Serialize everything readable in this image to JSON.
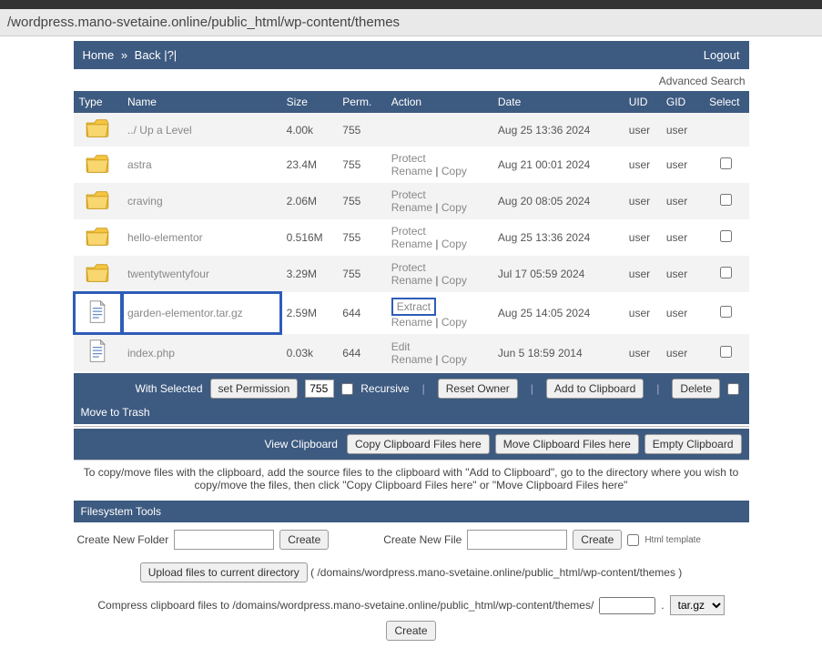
{
  "url": "/wordpress.mano-svetaine.online/public_html/wp-content/themes",
  "nav": {
    "home": "Home",
    "sep": "»",
    "back": "Back",
    "help": "|?|",
    "logout": "Logout"
  },
  "advanced": "Advanced Search",
  "headers": {
    "type": "Type",
    "name": "Name",
    "size": "Size",
    "perm": "Perm.",
    "action": "Action",
    "date": "Date",
    "uid": "UID",
    "gid": "GID",
    "select": "Select"
  },
  "rows": [
    {
      "kind": "folder",
      "name": "../ Up a Level",
      "size": "4.00k",
      "perm": "755",
      "actions": [],
      "date": "Aug 25 13:36 2024",
      "uid": "user",
      "gid": "user",
      "checkbox": false,
      "odd": true
    },
    {
      "kind": "folder",
      "name": "astra",
      "size": "23.4M",
      "perm": "755",
      "actions": [
        "Protect",
        "Rename",
        "Copy"
      ],
      "date": "Aug 21 00:01 2024",
      "uid": "user",
      "gid": "user",
      "checkbox": true,
      "odd": false
    },
    {
      "kind": "folder",
      "name": "craving",
      "size": "2.06M",
      "perm": "755",
      "actions": [
        "Protect",
        "Rename",
        "Copy"
      ],
      "date": "Aug 20 08:05 2024",
      "uid": "user",
      "gid": "user",
      "checkbox": true,
      "odd": true
    },
    {
      "kind": "folder",
      "name": "hello-elementor",
      "size": "0.516M",
      "perm": "755",
      "actions": [
        "Protect",
        "Rename",
        "Copy"
      ],
      "date": "Aug 25 13:36 2024",
      "uid": "user",
      "gid": "user",
      "checkbox": true,
      "odd": false
    },
    {
      "kind": "folder",
      "name": "twentytwentyfour",
      "size": "3.29M",
      "perm": "755",
      "actions": [
        "Protect",
        "Rename",
        "Copy"
      ],
      "date": "Jul 17 05:59 2024",
      "uid": "user",
      "gid": "user",
      "checkbox": true,
      "odd": true
    },
    {
      "kind": "file",
      "name": "garden-elementor.tar.gz",
      "size": "2.59M",
      "perm": "644",
      "actions": [
        "Extract",
        "Rename",
        "Copy"
      ],
      "date": "Aug 25 14:05 2024",
      "uid": "user",
      "gid": "user",
      "checkbox": true,
      "odd": false,
      "highlight": true
    },
    {
      "kind": "file",
      "name": "index.php",
      "size": "0.03k",
      "perm": "644",
      "actions": [
        "Edit",
        "Rename",
        "Copy"
      ],
      "date": "Jun 5 18:59 2014",
      "uid": "user",
      "gid": "user",
      "checkbox": true,
      "odd": true
    }
  ],
  "withSelected": {
    "label": "With Selected",
    "setPerm": "set Permission",
    "permVal": "755",
    "recursive": "Recursive",
    "resetOwner": "Reset Owner",
    "addClip": "Add to Clipboard",
    "delete": "Delete",
    "moveTrash": "Move to Trash"
  },
  "clipboard": {
    "view": "View Clipboard",
    "copyHere": "Copy Clipboard Files here",
    "moveHere": "Move Clipboard Files here",
    "empty": "Empty Clipboard"
  },
  "copyNote": "To copy/move files with the clipboard, add the source files to the clipboard with \"Add to Clipboard\", go to the directory where you wish to copy/move the files, then click \"Copy Clipboard Files here\" or \"Move Clipboard Files here\"",
  "tools": {
    "title": "Filesystem Tools",
    "createFolder": "Create New Folder",
    "createFile": "Create New File",
    "createBtn": "Create",
    "htmlTemplate": "Html template",
    "uploadBtn": "Upload files to current directory",
    "uploadPath": "( /domains/wordpress.mano-svetaine.online/public_html/wp-content/themes )",
    "compressLabel": "Compress clipboard files to /domains/wordpress.mano-svetaine.online/public_html/wp-content/themes/",
    "compressExt": "tar.gz",
    "compressBtn": "Create"
  }
}
